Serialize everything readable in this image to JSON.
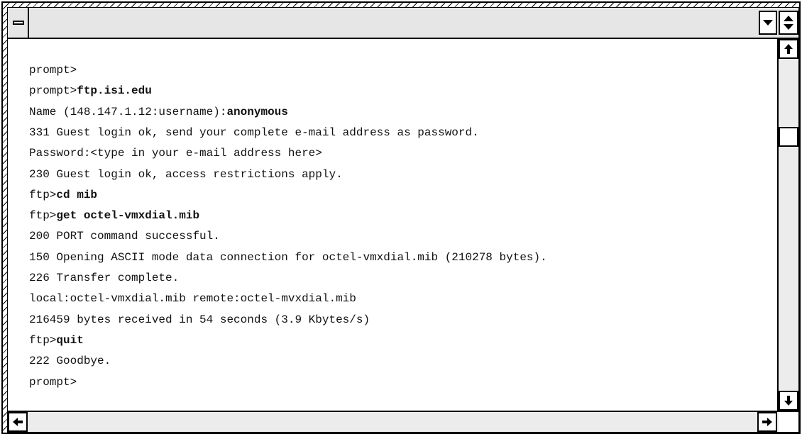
{
  "terminal": {
    "lines": [
      {
        "prefix": "prompt>",
        "command": ""
      },
      {
        "prefix": "prompt>",
        "command": "ftp.isi.edu"
      },
      {
        "prefix": "Name (148.147.1.12:username):",
        "command": "anonymous"
      },
      {
        "prefix": "331 Guest login ok, send your complete e-mail address as password.",
        "command": ""
      },
      {
        "prefix": "Password:<type in your e-mail address here>",
        "command": ""
      },
      {
        "prefix": "230 Guest login ok, access restrictions apply.",
        "command": ""
      },
      {
        "prefix": "ftp>",
        "command": "cd mib"
      },
      {
        "prefix": "ftp>",
        "command": "get octel-vmxdial.mib"
      },
      {
        "prefix": "200 PORT command successful.",
        "command": ""
      },
      {
        "prefix": "150 Opening ASCII mode data connection for octel-vmxdial.mib (210278 bytes).",
        "command": ""
      },
      {
        "prefix": "226 Transfer complete.",
        "command": ""
      },
      {
        "prefix": "local:octel-vmxdial.mib remote:octel-mvxdial.mib",
        "command": ""
      },
      {
        "prefix": "216459 bytes received in 54 seconds (3.9 Kbytes/s)",
        "command": ""
      },
      {
        "prefix": "ftp>",
        "command": "quit"
      },
      {
        "prefix": "222 Goodbye.",
        "command": ""
      },
      {
        "prefix": "prompt>",
        "command": ""
      }
    ]
  },
  "icons": {
    "system_menu": "system-menu-icon",
    "minimize": "minimize-icon",
    "maximize": "maximize-icon",
    "scroll_up": "arrow-up-icon",
    "scroll_down": "arrow-down-icon",
    "scroll_left": "arrow-left-icon",
    "scroll_right": "arrow-right-icon"
  },
  "colors": {
    "background": "#ffffff",
    "chrome": "#e6e6e6",
    "border": "#000000"
  }
}
